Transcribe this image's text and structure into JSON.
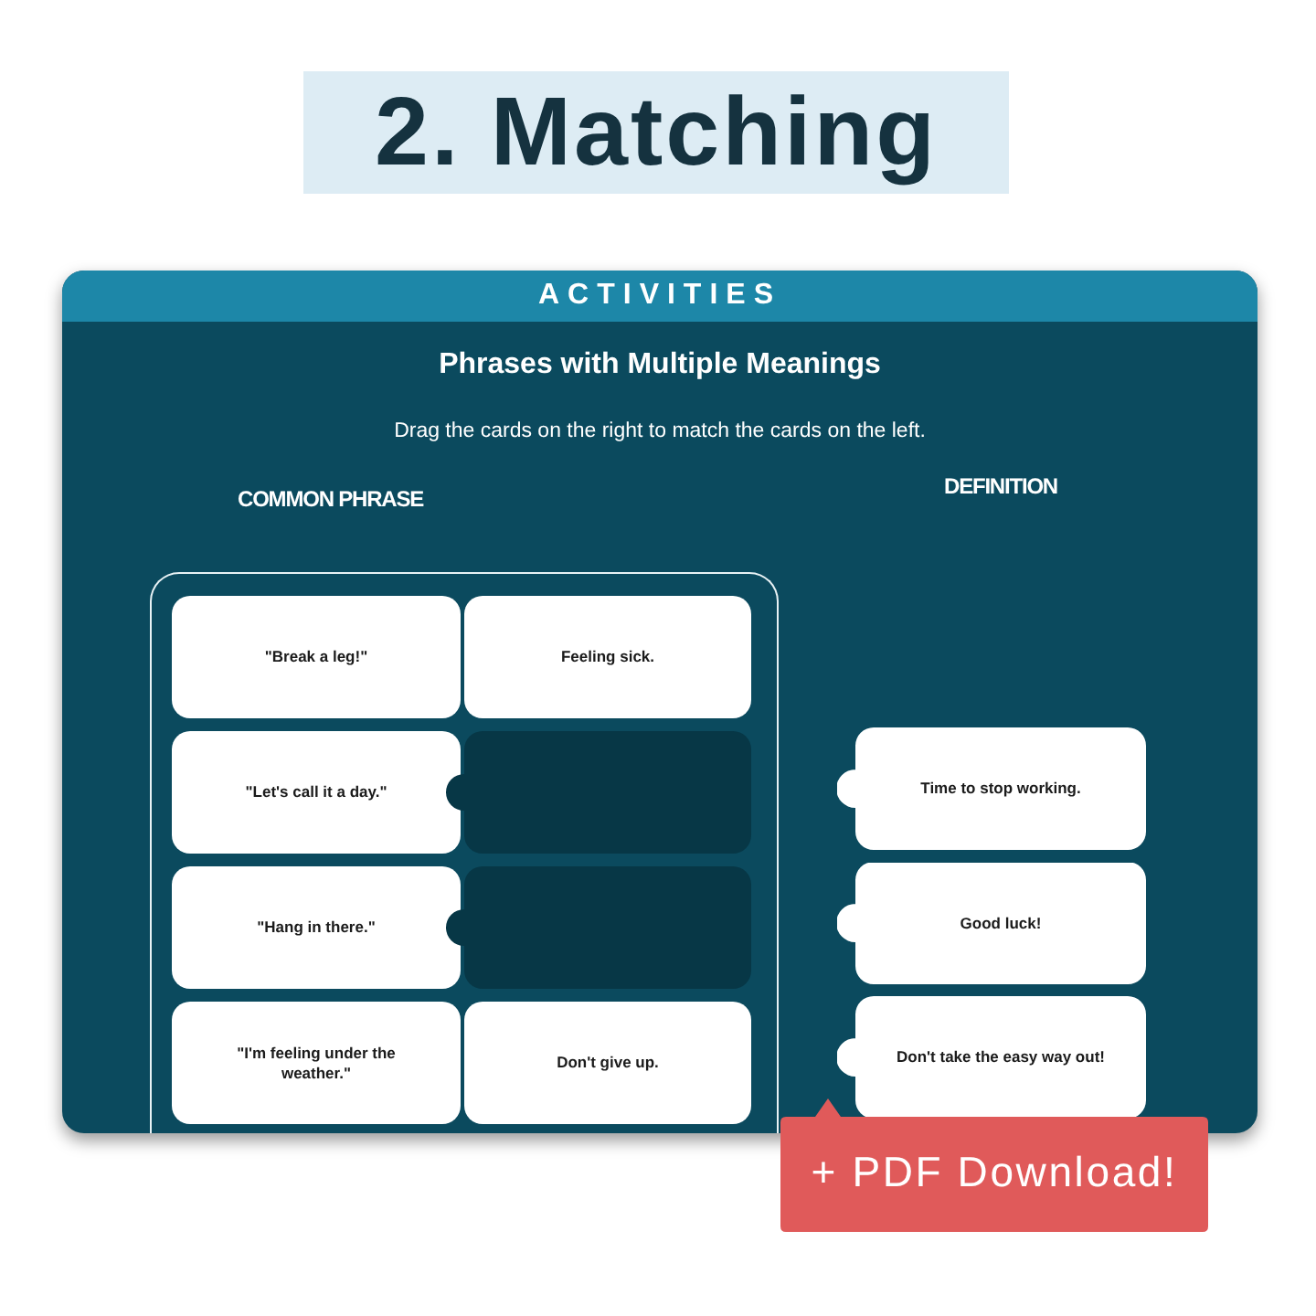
{
  "banner": {
    "title": "2. Matching"
  },
  "activity": {
    "header": "ACTIVITIES",
    "title": "Phrases with Multiple Meanings",
    "instructions": "Drag the cards on the right to match the cards on the left.",
    "left_heading": "COMMON PHRASE",
    "right_heading": "DEFINITION",
    "pairs": [
      {
        "phrase": "\"Break a leg!\"",
        "matched": true,
        "match": "Feeling sick."
      },
      {
        "phrase": "\"Let's call it a day.\"",
        "matched": false
      },
      {
        "phrase": "\"Hang in there.\"",
        "matched": false
      },
      {
        "phrase": "\"I'm feeling under the weather.\"",
        "matched": true,
        "match": "Don't give up."
      }
    ],
    "definitions": [
      "Time to stop working.",
      "Good luck!",
      "Don't take the easy way out!"
    ]
  },
  "download_button": {
    "label": "+ PDF Download!"
  }
}
